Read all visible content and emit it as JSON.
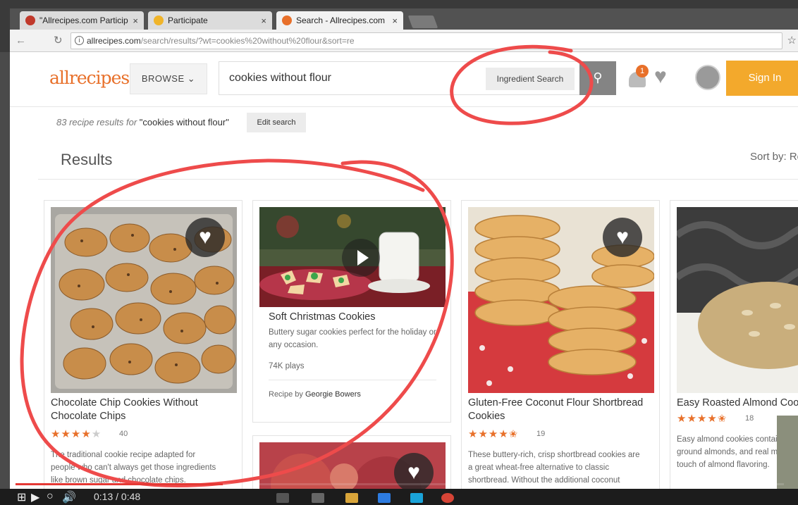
{
  "browser": {
    "tabs": [
      {
        "label": "\"Allrecipes.com Participa",
        "favicon_color": "#c0392b",
        "close": "×"
      },
      {
        "label": "Participate",
        "favicon_color": "#f0b429",
        "close": "×"
      },
      {
        "label": "Search - Allrecipes.com",
        "favicon_color": "#e8702a",
        "close": "×"
      }
    ],
    "url_host": "allrecipes.com",
    "url_path": "/search/results/?wt=cookies%20without%20flour&sort=re"
  },
  "header": {
    "logo": "allrecipes",
    "browse_label": "BROWSE",
    "search_value": "cookies without flour",
    "ingredient_search_label": "Ingredient Search",
    "notification_count": "1",
    "sign_in_label": "Sign In"
  },
  "results": {
    "count_text": "83 recipe results for",
    "query_text": "\"cookies without flour\"",
    "edit_label": "Edit search",
    "heading": "Results",
    "sort_label": "Sort by: Re"
  },
  "cards": [
    {
      "title_line1": "Chocolate Chip Cookies Without",
      "title_line2": "Chocolate Chips",
      "rating": 3.5,
      "reviews": "40",
      "desc_line1": "The traditional cookie recipe adapted for",
      "desc_line2": "people who can't always get those ingredients",
      "desc_line3": "like brown sugar and chocolate chips."
    },
    {
      "title": "Soft Christmas Cookies",
      "desc_line1": "Buttery sugar cookies perfect for the holiday or",
      "desc_line2": "any occasion.",
      "plays": "74K plays",
      "byline_prefix": "Recipe by",
      "author": "Georgie Bowers"
    },
    {
      "title_line1": "Gluten-Free Coconut Flour Shortbread",
      "title_line2": "Cookies",
      "rating": 4.5,
      "reviews": "19",
      "desc_line1": "These buttery-rich, crisp shortbread cookies are",
      "desc_line2": "a great wheat-free alternative to classic",
      "desc_line3": "shortbread. Without the additional coconut"
    },
    {
      "title": "Easy Roasted Almond Coo",
      "rating": 4.5,
      "reviews": "18",
      "desc_line1": "Easy almond cookies contain only",
      "desc_line2": "ground almonds, and real maple",
      "desc_line3": "touch of almond flavoring."
    }
  ],
  "video": {
    "time": "0:13 / 0:48",
    "progress": 0.27
  },
  "colors": {
    "brand": "#e8702a",
    "signin": "#f3a92c",
    "annotation": "#ee4b4b"
  }
}
